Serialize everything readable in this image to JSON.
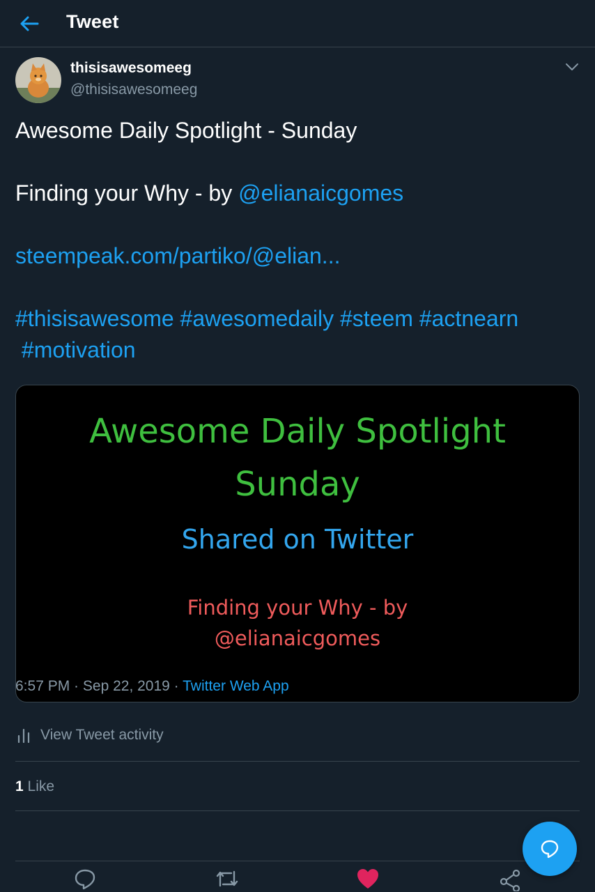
{
  "header": {
    "title": "Tweet",
    "back_icon": "arrow-left-icon"
  },
  "tweet": {
    "author": {
      "name": "thisisawesomeeg",
      "handle": "@thisisawesomeeg",
      "avatar": "cat-photo"
    },
    "text": {
      "line1": "Awesome Daily Spotlight - Sunday",
      "line2_prefix": "Finding your Why - by ",
      "line2_mention": "@elianaicgomes",
      "link": "steempeak.com/partiko/@elian...",
      "hashtags_line1": "#thisisawesome #awesomedaily #steem #actnearn",
      "hashtags_line2": " #motivation"
    },
    "media": {
      "line1": "Awesome Daily Spotlight",
      "line2": "Sunday",
      "line3": "Shared on Twitter",
      "line4": "Finding your Why - by",
      "line5": "@elianaicgomes"
    },
    "time": "6:57 PM",
    "separator": " · ",
    "date": "Sep 22, 2019",
    "source": "Twitter Web App",
    "activity_label": "View Tweet activity",
    "like_count": "1",
    "like_label": " Like"
  },
  "colors": {
    "background": "#15202b",
    "accent": "#1da1f2",
    "muted": "#8899a6",
    "like": "#e0245e",
    "border": "#38444d"
  }
}
